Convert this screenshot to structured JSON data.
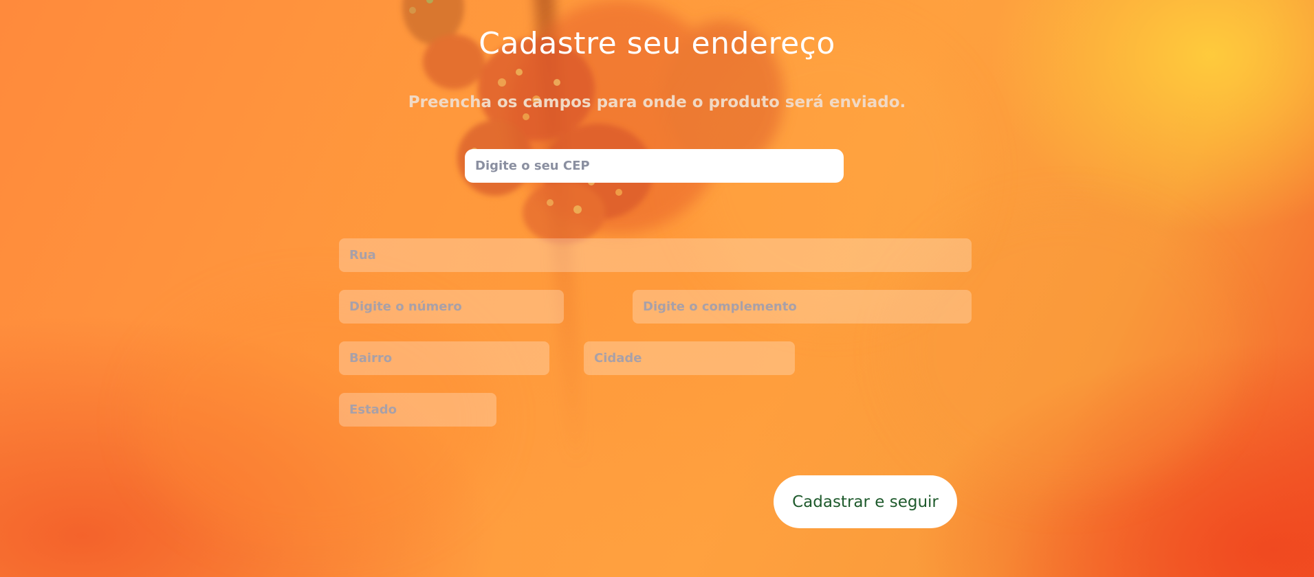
{
  "header": {
    "title": "Cadastre seu endereço",
    "subtitle": "Preencha os campos para onde o produto será enviado."
  },
  "form": {
    "cep": {
      "placeholder": "Digite o seu CEP",
      "value": ""
    },
    "rua": {
      "placeholder": "Rua",
      "value": ""
    },
    "numero": {
      "placeholder": "Digite o número",
      "value": ""
    },
    "complemento": {
      "placeholder": "Digite o complemento",
      "value": ""
    },
    "bairro": {
      "placeholder": "Bairro",
      "value": ""
    },
    "cidade": {
      "placeholder": "Cidade",
      "value": ""
    },
    "estado": {
      "placeholder": "Estado",
      "value": ""
    },
    "submit_label": "Cadastrar e seguir"
  },
  "colors": {
    "background_accent": "#ff9a3e",
    "submit_text": "#1e5a2c",
    "title_text": "#ffffff"
  }
}
